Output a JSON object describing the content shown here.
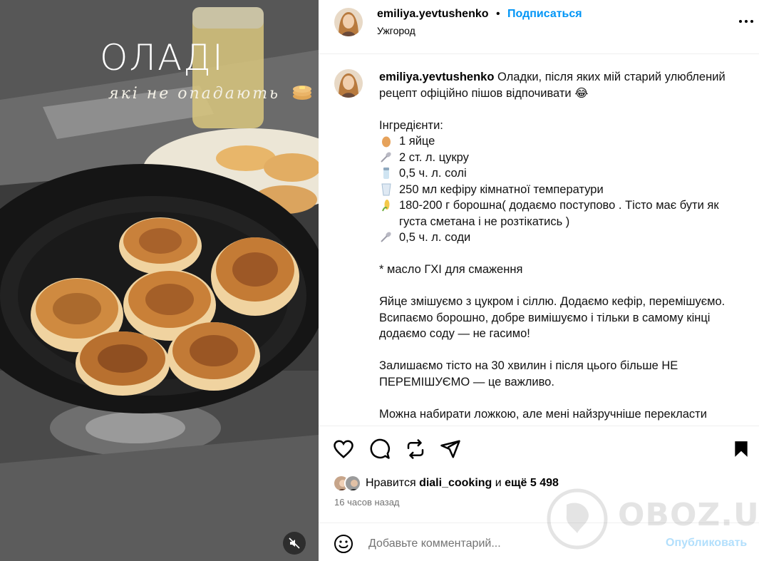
{
  "media": {
    "overlay_title": "ОЛАДІ",
    "overlay_subtitle": "які не опадають",
    "mute_icon": "speaker-muted-icon"
  },
  "header": {
    "username": "emiliya.yevtushenko",
    "separator": "•",
    "follow_label": "Подписаться",
    "location": "Ужгород"
  },
  "caption": {
    "username": "emiliya.yevtushenko",
    "intro": "Оладки, після яких мій старий улюблений рецепт офіційно пішов відпочивати 😂",
    "ingredients_title": "Інгредієнти:",
    "ingredients": [
      {
        "icon": "egg-icon",
        "text": "1 яйце"
      },
      {
        "icon": "spoon-icon",
        "text": "2 ст. л. цукру"
      },
      {
        "icon": "salt-icon",
        "text": "0,5 ч. л. солі"
      },
      {
        "icon": "glass-icon",
        "text": "250 мл кефіру кімнатної температури"
      },
      {
        "icon": "corn-icon",
        "text": "180-200 г борошна( додаємо поступово . Тісто має бути як густа сметана і не розтікатись )"
      },
      {
        "icon": "spoon-icon",
        "text": "0,5 ч. л. соди"
      }
    ],
    "oil_note": "* масло ГХІ для смаження",
    "step1": "Яйце змішуємо з цукром і сіллю. Додаємо кефір, перемішуємо. Всипаємо борошно, добре вимішуємо і тільки в самому кінці додаємо соду — не гасимо!",
    "step2": "Залишаємо тісто на 30 хвилин і після цього більше НЕ ПЕРЕМІШУЄМО — це важливо.",
    "step3": "Можна набирати ложкою, але мені найзручніше перекласти"
  },
  "actions": {
    "like_icon": "heart-icon",
    "comment_icon": "comment-icon",
    "repost_icon": "repost-icon",
    "share_icon": "send-icon",
    "save_icon": "bookmark-icon"
  },
  "likes": {
    "prefix": "Нравится",
    "user": "diali_cooking",
    "connector": "и",
    "more": "ещё 5 498"
  },
  "time_ago": "16 часов назад",
  "comment": {
    "placeholder": "Добавьте комментарий...",
    "publish_label": "Опубликовать"
  },
  "watermark": {
    "text": "OBOZ.UA"
  },
  "colors": {
    "accent_blue": "#0095f6",
    "publish_disabled": "#b2dffc",
    "secondary_text": "#737373",
    "divider": "#efefef"
  }
}
